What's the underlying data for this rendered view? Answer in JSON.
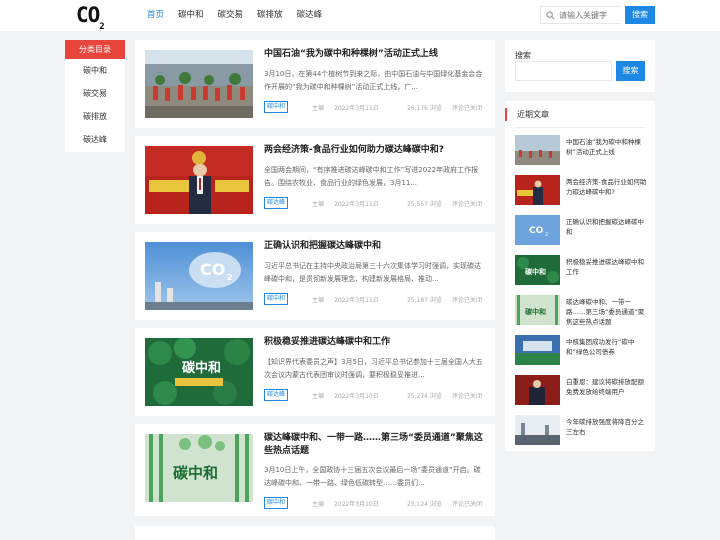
{
  "header": {
    "logo": "CO",
    "logo_sub": "2",
    "nav": [
      "首页",
      "碳中和",
      "碳交易",
      "碳排放",
      "碳达峰"
    ],
    "search_placeholder": "请输入关键字",
    "search_button": "搜索"
  },
  "categories": {
    "title": "分类目录",
    "items": [
      "碳中和",
      "碳交易",
      "碳排放",
      "碳达峰"
    ]
  },
  "posts": [
    {
      "title": "中国石油“我为碳中和种棵树”活动正式上线",
      "desc": "3月10日，在第44个植树节到来之际，由中国石油与中国绿化基金会合作开展的“我为碳中和种棵树”活动正式上线，广...",
      "tag": "碳中和",
      "author": "主编",
      "date": "2022年3月11日",
      "views": "26,176 浏览",
      "comment": "评论已关闭"
    },
    {
      "title": "两会经济策-食品行业如何助力碳达峰碳中和?",
      "desc": "全国两会期间，“有序推进碳达峰碳中和工作”写进2022年政府工作报告。围绕农牧业、食品行业的绿色发展，3月11...",
      "tag": "碳达峰",
      "author": "主编",
      "date": "2022年3月11日",
      "views": "25,557 浏览",
      "comment": "评论已关闭"
    },
    {
      "title": "正确认识和把握碳达峰碳中和",
      "desc": "习近平总书记在主持中央政治局第三十六次集体学习时强调，实现碳达峰碳中和，是贯彻新发展理念、构建新发展格局、推动...",
      "tag": "碳中和",
      "author": "主编",
      "date": "2022年3月11日",
      "views": "25,187 浏览",
      "comment": "评论已关闭"
    },
    {
      "title": "积极稳妥推进碳达峰碳中和工作",
      "desc": "【知识界代表委员之声】3月5日，习近平总书记参加十三届全国人大五次会议内蒙古代表团审议时强调，要积极稳妥推进...",
      "tag": "碳达峰",
      "author": "主编",
      "date": "2022年3月10日",
      "views": "25,274 浏览",
      "comment": "评论已关闭"
    },
    {
      "title": "碳达峰碳中和、一带一路……第三场“委员通道”聚焦这些热点话题",
      "desc": "3月10日上午，全国政协十三届五次会议最后一场“委员通道”开启。碳达峰碳中和、一带一路、绿色低碳转型……委员们...",
      "tag": "碳中和",
      "author": "主编",
      "date": "2022年3月10日",
      "views": "25,124 浏览",
      "comment": "评论已关闭"
    }
  ],
  "side_search": {
    "label": "搜索",
    "button": "搜索"
  },
  "recent": {
    "title": "近期文章",
    "items": [
      "中国石油“我为碳中和种棵树”活动正式上线",
      "两会经济策-食品行业如何助力碳达峰碳中和?",
      "正确认识和把握碳达峰碳中和",
      "积极稳妥推进碳达峰碳中和工作",
      "碳达峰碳中和、一带一路……第三场“委员通道”聚焦这些热点话题",
      "中核集团成功发行“碳中和”绿色公司债券",
      "白重恩：建议将碳排放配额免费发放给终端用户",
      "今年碳排放强度将降百分之三左右"
    ]
  },
  "colors": {
    "accent": "#1e88e5",
    "red": "#e8453c",
    "background": "#f2f3f5"
  }
}
